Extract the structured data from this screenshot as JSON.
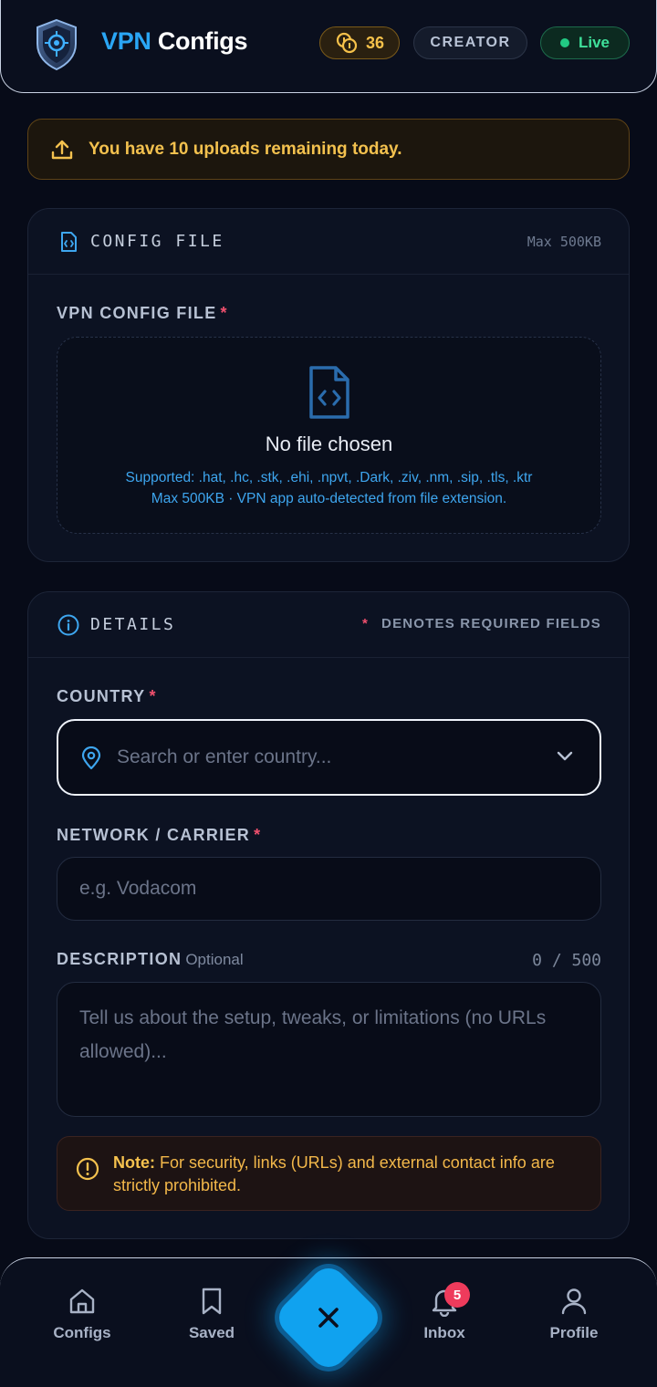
{
  "header": {
    "brand_part1": "VPN",
    "brand_part2": "Configs",
    "coins": "36",
    "role_badge": "CREATOR",
    "status": "Live"
  },
  "banner": {
    "text": "You have 10 uploads remaining today."
  },
  "config_card": {
    "title": "CONFIG FILE",
    "max_size": "Max 500KB",
    "field_label": "VPN CONFIG FILE",
    "required_mark": "*",
    "dropzone_title": "No file chosen",
    "supported_line": "Supported: .hat, .hc, .stk, .ehi, .npvt, .Dark, .ziv, .nm, .sip, .tls, .ktr",
    "hint_line": "Max 500KB · VPN app auto-detected from file extension."
  },
  "details_card": {
    "title": "DETAILS",
    "required_note_star": "*",
    "required_note": "DENOTES REQUIRED FIELDS",
    "country": {
      "label": "COUNTRY",
      "placeholder": "Search or enter country..."
    },
    "network": {
      "label": "NETWORK / CARRIER",
      "placeholder": "e.g. Vodacom"
    },
    "description": {
      "label": "DESCRIPTION",
      "optional": "Optional",
      "counter": "0 / 500",
      "placeholder": "Tell us about the setup, tweaks, or limitations (no URLs allowed)..."
    },
    "note": {
      "title": "Note:",
      "text": " For security, links (URLs) and external contact info are strictly prohibited."
    }
  },
  "bottom_nav": {
    "items": [
      {
        "label": "Configs",
        "icon": "home-icon"
      },
      {
        "label": "Saved",
        "icon": "bookmark-icon"
      },
      {
        "label": "Inbox",
        "icon": "bell-icon"
      },
      {
        "label": "Profile",
        "icon": "user-icon"
      }
    ],
    "inbox_badge": "5",
    "fab_icon": "close-icon"
  },
  "colors": {
    "accent": "#10a2ef",
    "warning": "#f3c14e",
    "required": "#f0506e",
    "live": "#22c983"
  }
}
